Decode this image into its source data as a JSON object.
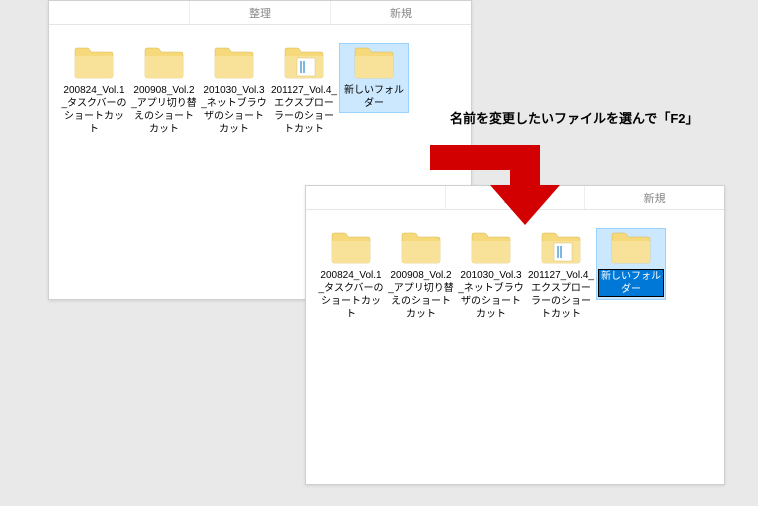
{
  "toolbar": {
    "section1": "整理",
    "section2": "新規"
  },
  "window1": {
    "items": [
      {
        "label": "200824_Vol.1_タスクバーのショートカット"
      },
      {
        "label": "200908_Vol.2_アプリ切り替えのショートカット"
      },
      {
        "label": "201030_Vol.3_ネットブラウザのショートカット"
      },
      {
        "label": "201127_Vol.4_エクスプローラーのショートカット"
      },
      {
        "label": "新しいフォルダー",
        "selected": true
      }
    ]
  },
  "window2": {
    "items": [
      {
        "label": "200824_Vol.1_タスクバーのショートカット"
      },
      {
        "label": "200908_Vol.2_アプリ切り替えのショートカット"
      },
      {
        "label": "201030_Vol.3_ネットブラウザのショートカット"
      },
      {
        "label": "201127_Vol.4_エクスプローラーのショートカット"
      },
      {
        "label": "新しいフォルダー",
        "selected": true,
        "editing": true
      }
    ]
  },
  "annotation": "名前を変更したいファイルを選んで「F2」"
}
